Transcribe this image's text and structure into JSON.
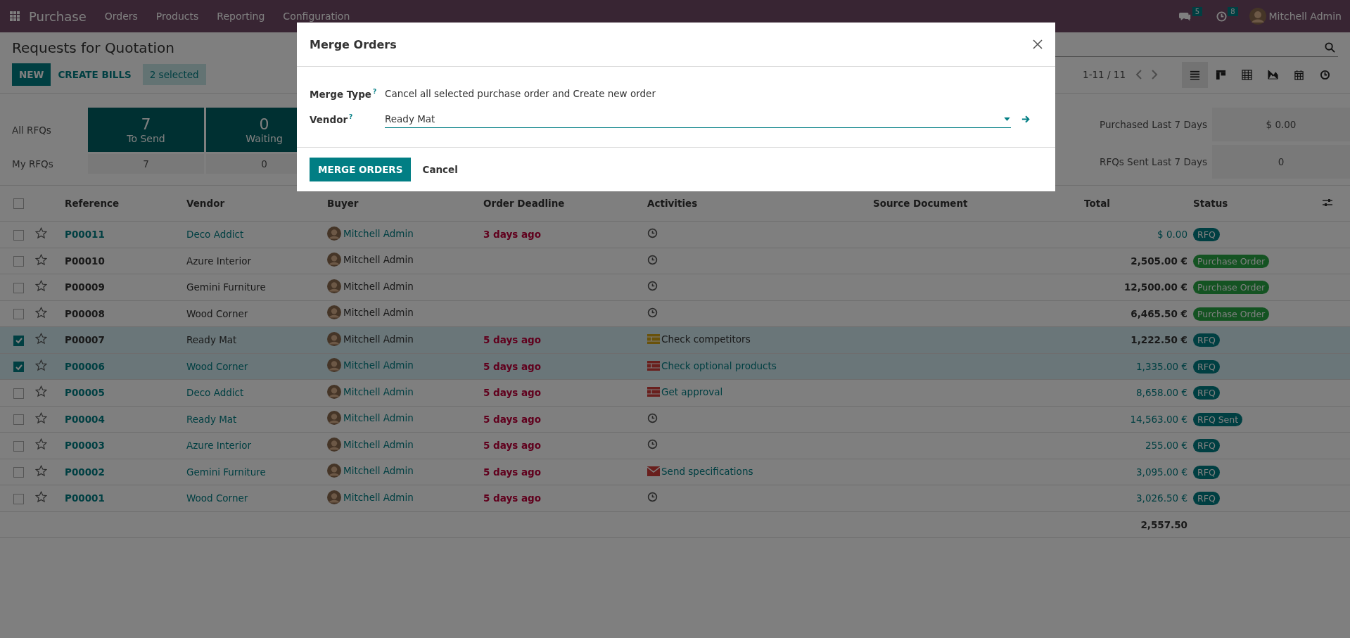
{
  "navbar": {
    "app": "Purchase",
    "menu": [
      "Orders",
      "Products",
      "Reporting",
      "Configuration"
    ],
    "messages_count": "5",
    "activities_count": "8",
    "user": "Mitchell Admin"
  },
  "control_panel": {
    "title": "Requests for Quotation",
    "buttons": [
      "NEW",
      "CREATE BILLS"
    ],
    "selection": "2 selected",
    "pager": "1-11 / 11",
    "views": [
      {
        "kind": "list",
        "selected": true
      },
      {
        "kind": "kanban",
        "selected": false
      },
      {
        "kind": "pivot",
        "selected": false
      },
      {
        "kind": "graph",
        "selected": false
      },
      {
        "kind": "calendar",
        "selected": false
      },
      {
        "kind": "activity",
        "selected": false
      }
    ]
  },
  "dashboard": {
    "row_labels": [
      "All RFQs",
      "My RFQs"
    ],
    "tiles": [
      {
        "value": "7",
        "label": "To Send",
        "mine": "7"
      },
      {
        "value": "0",
        "label": "Waiting",
        "mine": "0"
      }
    ],
    "stats": [
      {
        "label": "Purchased Last 7 Days",
        "value": "$ 0.00"
      },
      {
        "label": "RFQs Sent Last 7 Days",
        "value": "0"
      }
    ]
  },
  "table": {
    "all_checked": false,
    "columns": [
      "Reference",
      "Vendor",
      "Buyer",
      "Order Deadline",
      "Activities",
      "Source Document",
      "Total",
      "Status"
    ],
    "rows": [
      {
        "selected": false,
        "starred": false,
        "info": true,
        "reference": "P00011",
        "vendor": "Deco Addict",
        "buyer": "Mitchell Admin",
        "deadline": "3 days ago",
        "activity": {
          "kind": "clock"
        },
        "total": "$ 0.00",
        "status": {
          "label": "RFQ",
          "kind": "rfq"
        }
      },
      {
        "selected": false,
        "starred": false,
        "info": false,
        "reference": "P00010",
        "vendor": "Azure Interior",
        "buyer": "Mitchell Admin",
        "activity": {
          "kind": "clock"
        },
        "total": "2,505.00 €",
        "status": {
          "label": "Purchase Order",
          "kind": "purchase"
        }
      },
      {
        "selected": false,
        "starred": false,
        "info": false,
        "reference": "P00009",
        "vendor": "Gemini Furniture",
        "buyer": "Mitchell Admin",
        "activity": {
          "kind": "clock"
        },
        "total": "12,500.00 €",
        "status": {
          "label": "Purchase Order",
          "kind": "purchase"
        }
      },
      {
        "selected": false,
        "starred": false,
        "info": false,
        "reference": "P00008",
        "vendor": "Wood Corner",
        "buyer": "Mitchell Admin",
        "activity": {
          "kind": "clock"
        },
        "total": "6,465.50 €",
        "status": {
          "label": "Purchase Order",
          "kind": "purchase"
        }
      },
      {
        "selected": true,
        "starred": false,
        "info": false,
        "reference": "P00007",
        "vendor": "Ready Mat",
        "buyer": "Mitchell Admin",
        "deadline": "5 days ago",
        "activity": {
          "kind": "todo",
          "label": "Check competitors",
          "color": "#69520b"
        },
        "total": "1,222.50 €",
        "status": {
          "label": "RFQ",
          "kind": "rfq"
        }
      },
      {
        "selected": true,
        "starred": false,
        "info": true,
        "reference": "P00006",
        "vendor": "Wood Corner",
        "buyer": "Mitchell Admin",
        "deadline": "5 days ago",
        "activity": {
          "kind": "todo",
          "label": "Check optional products",
          "color": "#691f1d"
        },
        "total": "1,335.00 €",
        "status": {
          "label": "RFQ",
          "kind": "rfq"
        }
      },
      {
        "selected": false,
        "starred": false,
        "info": true,
        "reference": "P00005",
        "vendor": "Deco Addict",
        "buyer": "Mitchell Admin",
        "deadline": "5 days ago",
        "activity": {
          "kind": "todo",
          "label": "Get approval",
          "color": "#691f1d"
        },
        "total": "8,658.00 €",
        "status": {
          "label": "RFQ",
          "kind": "rfq"
        }
      },
      {
        "selected": false,
        "starred": false,
        "info": true,
        "reference": "P00004",
        "vendor": "Ready Mat",
        "buyer": "Mitchell Admin",
        "deadline": "5 days ago",
        "activity": {
          "kind": "clock"
        },
        "total": "14,563.00 €",
        "status": {
          "label": "RFQ Sent",
          "kind": "rfq"
        }
      },
      {
        "selected": false,
        "starred": false,
        "info": true,
        "reference": "P00003",
        "vendor": "Azure Interior",
        "buyer": "Mitchell Admin",
        "deadline": "5 days ago",
        "activity": {
          "kind": "clock"
        },
        "total": "255.00 €",
        "status": {
          "label": "RFQ",
          "kind": "rfq"
        }
      },
      {
        "selected": false,
        "starred": false,
        "info": true,
        "reference": "P00002",
        "vendor": "Gemini Furniture",
        "buyer": "Mitchell Admin",
        "deadline": "5 days ago",
        "activity": {
          "kind": "email",
          "label": "Send specifications",
          "color": "#691f1d"
        },
        "total": "3,095.00 €",
        "status": {
          "label": "RFQ",
          "kind": "rfq"
        }
      },
      {
        "selected": false,
        "starred": false,
        "info": true,
        "reference": "P00001",
        "vendor": "Wood Corner",
        "buyer": "Mitchell Admin",
        "deadline": "5 days ago",
        "activity": {
          "kind": "clock"
        },
        "total": "3,026.50 €",
        "status": {
          "label": "RFQ",
          "kind": "rfq"
        }
      }
    ],
    "total": "2,557.50"
  },
  "dialog": {
    "title": "Merge Orders",
    "fields": [
      {
        "kind": "text",
        "label": "Merge Type",
        "help": "?",
        "value": "Cancel all selected purchase order and Create new order"
      },
      {
        "kind": "many2one",
        "label": "Vendor",
        "help": "?",
        "value": "Ready Mat"
      }
    ],
    "buttons": [
      {
        "label": "MERGE ORDERS",
        "primary": true
      },
      {
        "label": "Cancel",
        "primary": false
      }
    ]
  }
}
